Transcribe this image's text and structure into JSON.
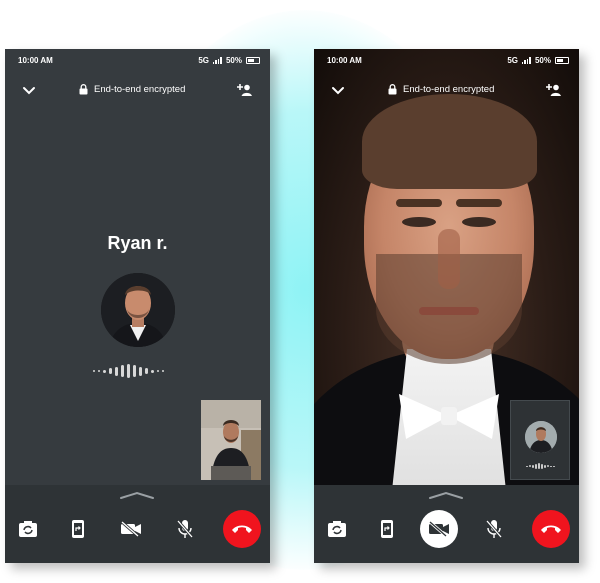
{
  "screens": [
    {
      "status": {
        "time": "10:00 AM",
        "network": "5G",
        "battery": "50%"
      },
      "header": {
        "encryption": "End-to-end encrypted"
      },
      "caller": {
        "name": "Ryan r."
      },
      "view": "voice",
      "controls": [
        "flip-camera",
        "share-screen",
        "video-off",
        "mute",
        "end-call"
      ]
    },
    {
      "status": {
        "time": "10:00 AM",
        "network": "5G",
        "battery": "50%"
      },
      "header": {
        "encryption": "End-to-end encrypted"
      },
      "view": "video",
      "controls": [
        "flip-camera",
        "share-screen",
        "video-off-active",
        "mute",
        "end-call"
      ]
    }
  ],
  "colors": {
    "background": "#363b3f",
    "control_bar": "#2e3336",
    "end_call": "#f0141e",
    "glow": "#8ff3f5"
  }
}
